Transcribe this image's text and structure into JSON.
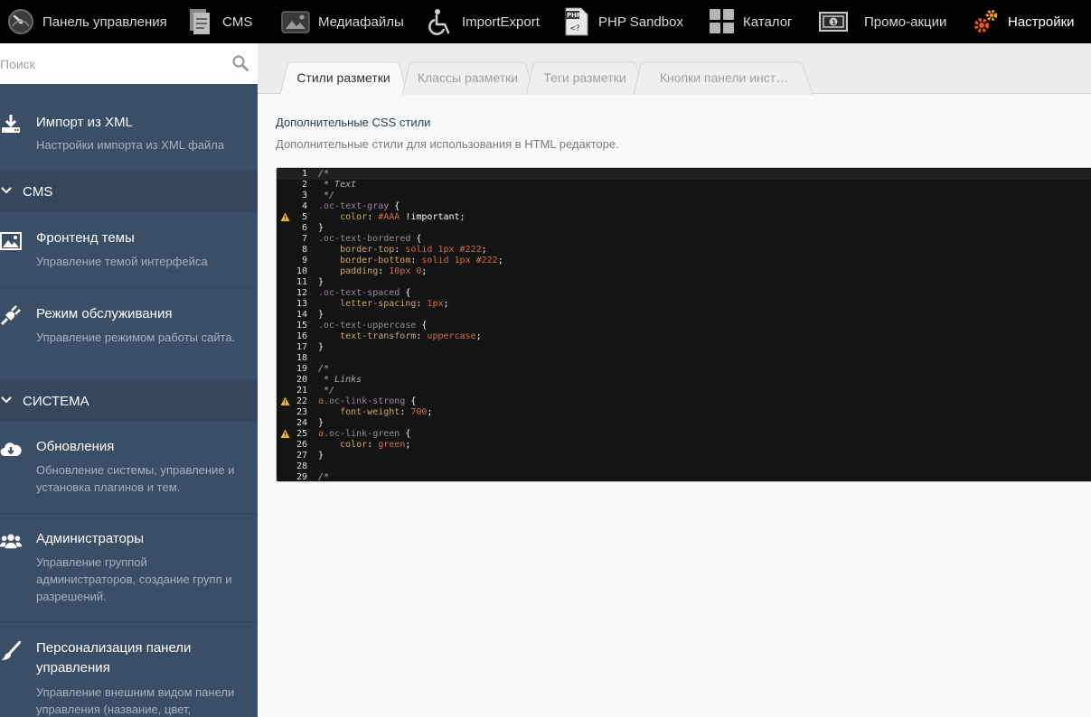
{
  "topnav": {
    "items": [
      {
        "label": "Панель управления",
        "icon": "dashboard-gauge-icon",
        "active": false
      },
      {
        "label": "CMS",
        "icon": "cms-pages-icon",
        "active": false
      },
      {
        "label": "Медиафайлы",
        "icon": "media-camera-icon",
        "active": false
      },
      {
        "label": "ImportExport",
        "icon": "wheelchair-icon",
        "active": false
      },
      {
        "label": "PHP Sandbox",
        "icon": "php-file-icon",
        "active": false
      },
      {
        "label": "Каталог",
        "icon": "catalog-grid-icon",
        "active": false
      },
      {
        "label": "Промо-акции",
        "icon": "money-bill-icon",
        "active": false
      },
      {
        "label": "Настройки",
        "icon": "settings-gears-icon",
        "active": true
      }
    ]
  },
  "sidebar": {
    "search_placeholder": "Поиск",
    "entries": [
      {
        "title": "Импорт из XML",
        "desc": "Настройки импорта из XML файла",
        "icon": "download-icon"
      },
      {
        "section": "CMS"
      },
      {
        "title": "Фронтенд темы",
        "desc": "Управление темой интерфейса",
        "icon": "image-icon"
      },
      {
        "title": "Режим обслуживания",
        "desc": "Управление режимом работы сайта.",
        "icon": "plug-icon"
      },
      {
        "section": "СИСТЕМА"
      },
      {
        "title": "Обновления",
        "desc": "Обновление системы, управление и установка плагинов и тем.",
        "icon": "cloud-download-icon"
      },
      {
        "title": "Администраторы",
        "desc": "Управление группой администраторов, создание групп и разрешений.",
        "icon": "users-icon"
      },
      {
        "title": "Персонализация панели управления",
        "desc": "Управление внешним видом панели управления (название, цвет,",
        "icon": "brush-icon"
      }
    ]
  },
  "tabs": [
    {
      "label": "Стили разметки",
      "active": true
    },
    {
      "label": "Классы разметки",
      "active": false
    },
    {
      "label": "Теги разметки",
      "active": false
    },
    {
      "label": "Кнопки панели инст…",
      "active": false
    }
  ],
  "field": {
    "label": "Дополнительные CSS стили",
    "help": "Дополнительные стили для использования в HTML редакторе."
  },
  "editor": {
    "warning_icon": "warning-triangle-icon",
    "lines": [
      {
        "n": "1",
        "warn": false,
        "parts": [
          [
            "c-com",
            "/*"
          ]
        ]
      },
      {
        "n": "2",
        "warn": false,
        "parts": [
          [
            "c-com",
            " * Text"
          ]
        ]
      },
      {
        "n": "3",
        "warn": false,
        "parts": [
          [
            "c-com",
            " */"
          ]
        ]
      },
      {
        "n": "4",
        "warn": false,
        "parts": [
          [
            "c-sel",
            ".oc-text-gray"
          ],
          [
            "c-txt",
            " {"
          ]
        ]
      },
      {
        "n": "5",
        "warn": true,
        "parts": [
          [
            "c-prop",
            "    color"
          ],
          [
            "c-txt",
            ": "
          ],
          [
            "c-val",
            "#AAA"
          ],
          [
            "c-txt",
            " !important;"
          ]
        ]
      },
      {
        "n": "6",
        "warn": false,
        "parts": [
          [
            "c-txt",
            "}"
          ]
        ]
      },
      {
        "n": "7",
        "warn": false,
        "parts": [
          [
            "c-sel",
            ".oc-text-bordered"
          ],
          [
            "c-txt",
            " {"
          ]
        ]
      },
      {
        "n": "8",
        "warn": false,
        "parts": [
          [
            "c-prop",
            "    border-top"
          ],
          [
            "c-txt",
            ": "
          ],
          [
            "c-val",
            "solid 1px #222"
          ],
          [
            "c-txt",
            ";"
          ]
        ]
      },
      {
        "n": "9",
        "warn": false,
        "parts": [
          [
            "c-prop",
            "    border-bottom"
          ],
          [
            "c-txt",
            ": "
          ],
          [
            "c-val",
            "solid 1px #222"
          ],
          [
            "c-txt",
            ";"
          ]
        ]
      },
      {
        "n": "10",
        "warn": false,
        "parts": [
          [
            "c-prop",
            "    padding"
          ],
          [
            "c-txt",
            ": "
          ],
          [
            "c-val",
            "10px 0"
          ],
          [
            "c-txt",
            ";"
          ]
        ]
      },
      {
        "n": "11",
        "warn": false,
        "parts": [
          [
            "c-txt",
            "}"
          ]
        ]
      },
      {
        "n": "12",
        "warn": false,
        "parts": [
          [
            "c-sel",
            ".oc-text-spaced"
          ],
          [
            "c-txt",
            " {"
          ]
        ]
      },
      {
        "n": "13",
        "warn": false,
        "parts": [
          [
            "c-prop",
            "    letter-spacing"
          ],
          [
            "c-txt",
            ": "
          ],
          [
            "c-val",
            "1px"
          ],
          [
            "c-txt",
            ";"
          ]
        ]
      },
      {
        "n": "14",
        "warn": false,
        "parts": [
          [
            "c-txt",
            "}"
          ]
        ]
      },
      {
        "n": "15",
        "warn": false,
        "parts": [
          [
            "c-sel",
            ".oc-text-uppercase"
          ],
          [
            "c-txt",
            " {"
          ]
        ]
      },
      {
        "n": "16",
        "warn": false,
        "parts": [
          [
            "c-prop",
            "    text-transform"
          ],
          [
            "c-txt",
            ": "
          ],
          [
            "c-val",
            "uppercase"
          ],
          [
            "c-txt",
            ";"
          ]
        ]
      },
      {
        "n": "17",
        "warn": false,
        "parts": [
          [
            "c-txt",
            "}"
          ]
        ]
      },
      {
        "n": "18",
        "warn": false,
        "parts": []
      },
      {
        "n": "19",
        "warn": false,
        "parts": [
          [
            "c-com",
            "/*"
          ]
        ]
      },
      {
        "n": "20",
        "warn": false,
        "parts": [
          [
            "c-com",
            " * Links"
          ]
        ]
      },
      {
        "n": "21",
        "warn": false,
        "parts": [
          [
            "c-com",
            " */"
          ]
        ]
      },
      {
        "n": "22",
        "warn": true,
        "parts": [
          [
            "c-val",
            "a"
          ],
          [
            "c-sel",
            ".oc-link-strong"
          ],
          [
            "c-txt",
            " {"
          ]
        ]
      },
      {
        "n": "23",
        "warn": false,
        "parts": [
          [
            "c-prop",
            "    font-weight"
          ],
          [
            "c-txt",
            ": "
          ],
          [
            "c-val",
            "700"
          ],
          [
            "c-txt",
            ";"
          ]
        ]
      },
      {
        "n": "24",
        "warn": false,
        "parts": [
          [
            "c-txt",
            "}"
          ]
        ]
      },
      {
        "n": "25",
        "warn": true,
        "parts": [
          [
            "c-val",
            "a"
          ],
          [
            "c-sel",
            ".oc-link-green"
          ],
          [
            "c-txt",
            " {"
          ]
        ]
      },
      {
        "n": "26",
        "warn": false,
        "parts": [
          [
            "c-prop",
            "    color"
          ],
          [
            "c-txt",
            ": "
          ],
          [
            "c-val",
            "green"
          ],
          [
            "c-txt",
            ";"
          ]
        ]
      },
      {
        "n": "27",
        "warn": false,
        "parts": [
          [
            "c-txt",
            "}"
          ]
        ]
      },
      {
        "n": "28",
        "warn": false,
        "parts": []
      },
      {
        "n": "29",
        "warn": false,
        "parts": [
          [
            "c-com",
            "/*"
          ]
        ]
      }
    ]
  }
}
